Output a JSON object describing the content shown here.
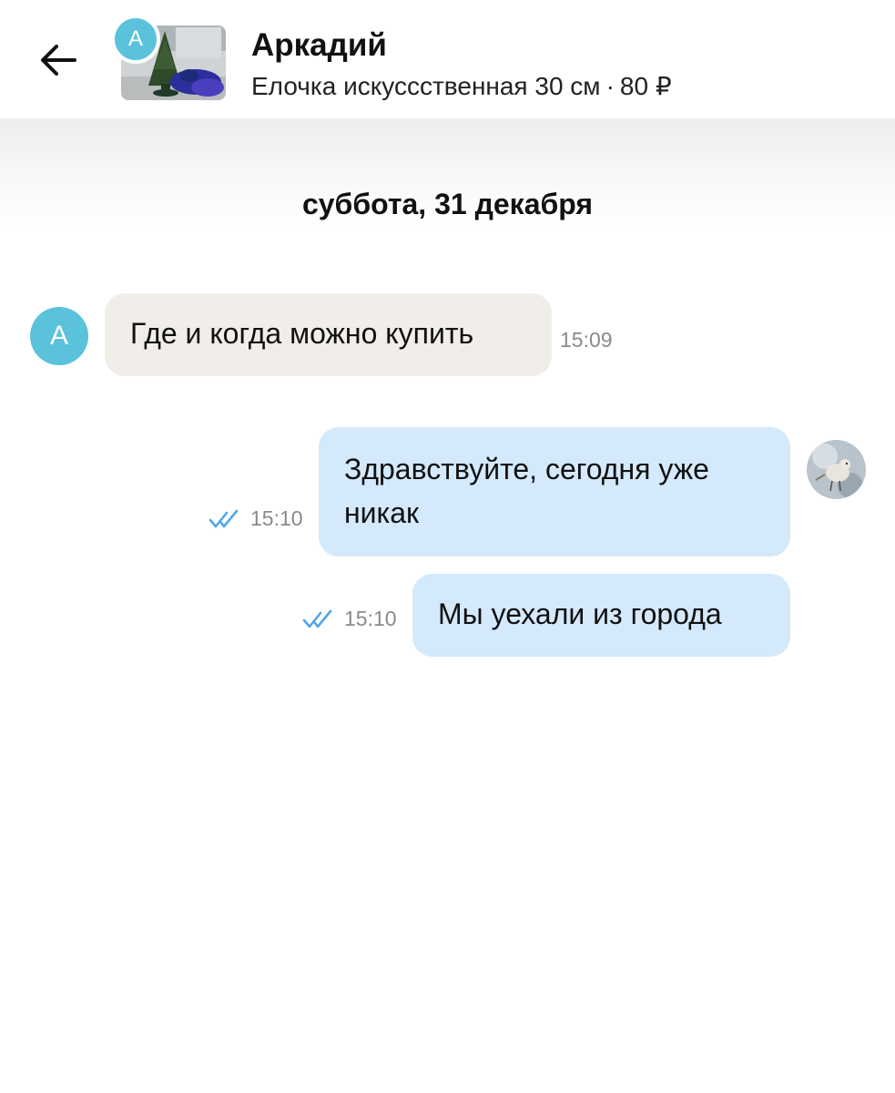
{
  "header": {
    "back_icon": "arrow-left-icon",
    "contact_name": "Аркадий",
    "contact_initial": "А",
    "item_title": "Елочка искусccтвенная 30 см",
    "separator": "·",
    "item_price": "80 ₽"
  },
  "date_separator": "суббота, 31 декабря",
  "messages": [
    {
      "direction": "incoming",
      "avatar_initial": "А",
      "text": "Где и когда можно купить",
      "time": "15:09"
    },
    {
      "direction": "outgoing",
      "lines": [
        "Здравствуйте, сегодня уже",
        "никак"
      ],
      "time": "15:10",
      "status_icon": "double-check-icon"
    },
    {
      "direction": "outgoing",
      "text": "Мы уехали из города",
      "time": "15:10",
      "status_icon": "double-check-icon"
    }
  ],
  "colors": {
    "incoming_bubble": "#f1eeea",
    "outgoing_bubble": "#d4e9fb",
    "avatar_accent": "#5bc2dc",
    "read_check": "#4fa6e8"
  }
}
